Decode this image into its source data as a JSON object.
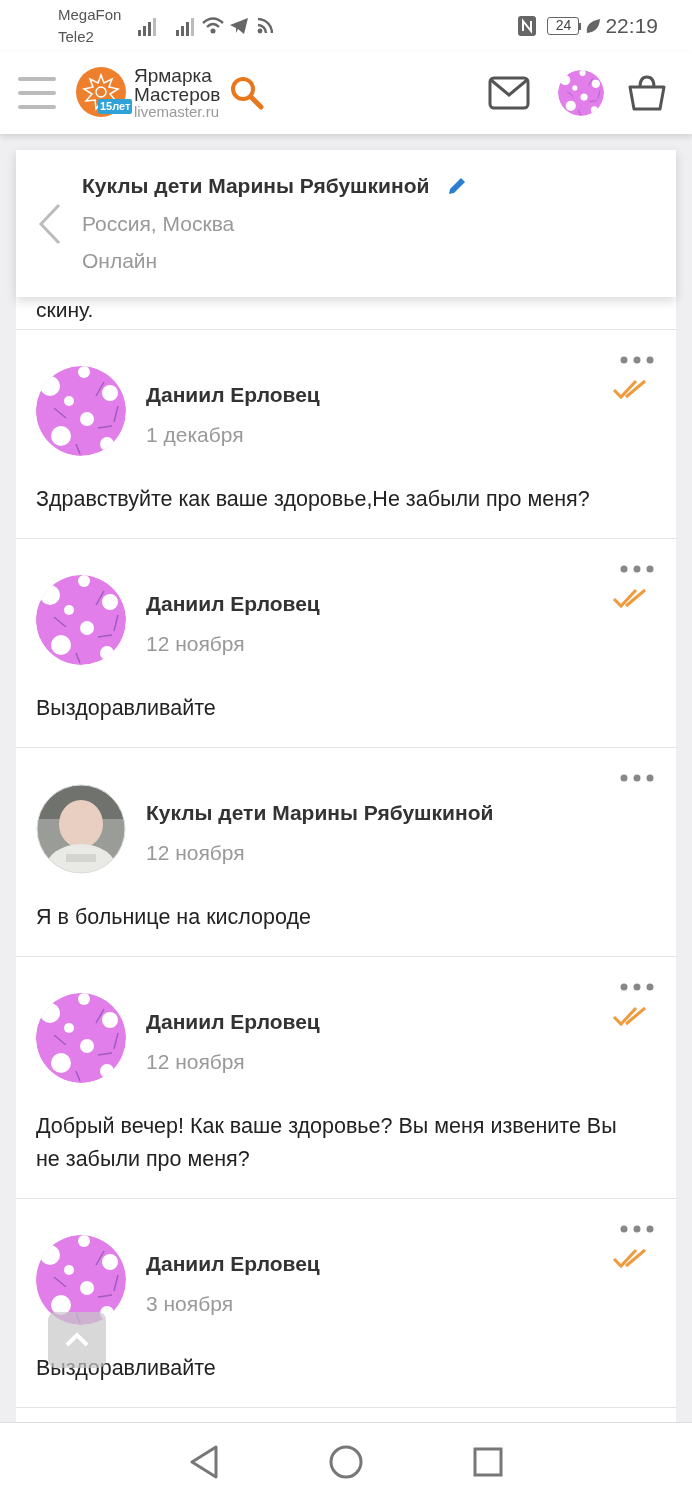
{
  "status_bar": {
    "carriers": [
      "MegaFon",
      "Tele2"
    ],
    "battery": "24",
    "time": "22:19"
  },
  "header": {
    "logo_lines": [
      "Ярмарка",
      "Мастеров"
    ],
    "logo_badge": "15лет",
    "logo_domain": "livemaster.ru"
  },
  "chat": {
    "title": "Куклы дети Марины Рябушкиной",
    "location": "Россия, Москва",
    "presence": "Онлайн"
  },
  "previous_text": "скину.",
  "messages": [
    {
      "author": "Даниил Ерловец",
      "date": "1 декабря",
      "text": "Здравствуйте как ваше здоровье,Не забыли про меня?",
      "kind": "pattern",
      "read": true
    },
    {
      "author": "Даниил Ерловец",
      "date": "12 ноября",
      "text": "Выздоравливайте",
      "kind": "pattern",
      "read": true
    },
    {
      "author": "Куклы дети Марины Рябушкиной",
      "date": "12 ноября",
      "text": "Я в больнице на кислороде",
      "read": false
    },
    {
      "author": "Даниил Ерловец",
      "date": "12 ноября",
      "text": "Добрый вечер! Как ваше здоровье? Вы меня извените Вы не забыли про меня?",
      "kind": "pattern",
      "read": true
    },
    {
      "author": "Даниил Ерловец",
      "date": "3 ноября",
      "text": "Выздоравливайте",
      "kind": "pattern",
      "read": true
    }
  ]
}
